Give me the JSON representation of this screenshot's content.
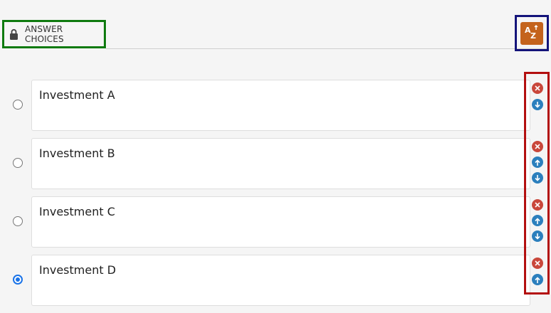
{
  "header": {
    "label": "ANSWER CHOICES",
    "lock_icon": "lock-icon"
  },
  "sort": {
    "icon": "sort-az-icon",
    "color": "#c4631c"
  },
  "choices": [
    {
      "label": "Investment A",
      "selected": false
    },
    {
      "label": "Investment B",
      "selected": false
    },
    {
      "label": "Investment C",
      "selected": false
    },
    {
      "label": "Investment D",
      "selected": true
    }
  ],
  "colors": {
    "delete": "#c9473b",
    "move": "#2b7fbd",
    "radio_selected": "#1a73e8"
  }
}
